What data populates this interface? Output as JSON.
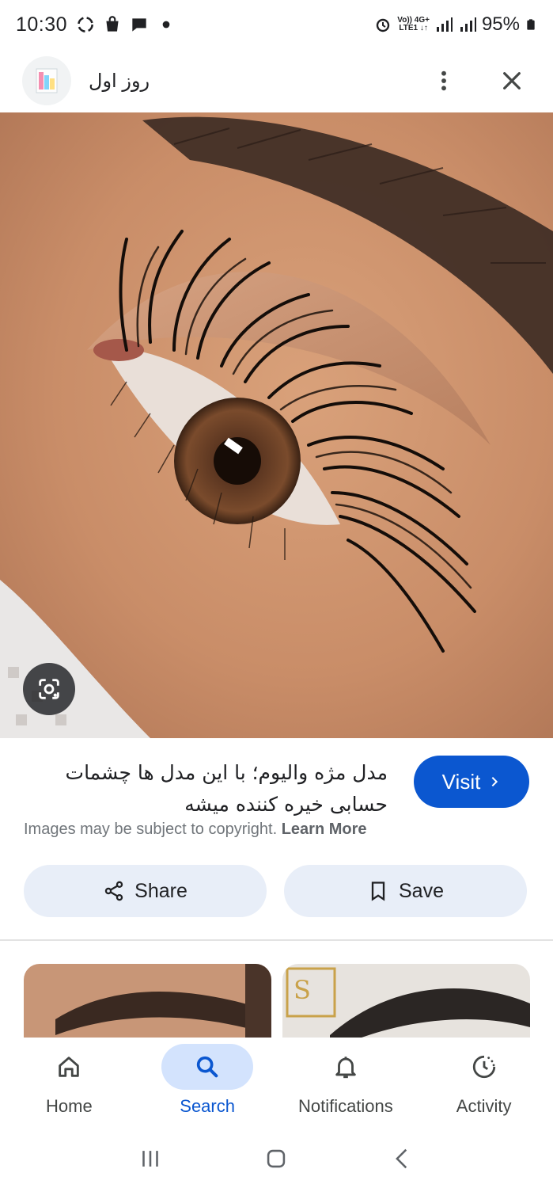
{
  "status_bar": {
    "time": "10:30",
    "battery": "95%",
    "network_top": "Vo)) 4G+",
    "network_bottom": "LTE1 ↓↑",
    "icons": [
      "sync-icon",
      "store-icon",
      "chat-icon",
      "dot-icon",
      "alarm-icon",
      "signal-icon",
      "signal-icon",
      "battery-icon"
    ]
  },
  "app_bar": {
    "site_name": "روز اول",
    "favicon": "site-favicon-icon",
    "more_icon": "more-vert-icon",
    "close_icon": "close-icon"
  },
  "image": {
    "subject": "eyelash-closeup-photo",
    "lens_icon": "google-lens-icon"
  },
  "caption": {
    "title": "مدل مژه والیوم؛ با این مدل ها چشمات حسابی خیره کننده میشه",
    "visit_label": "Visit",
    "copyright_text": "Images may be subject to copyright.",
    "learn_more": "Learn More"
  },
  "actions": {
    "share_label": "Share",
    "save_label": "Save"
  },
  "bottom_nav": {
    "items": [
      {
        "label": "Home",
        "icon": "home-icon"
      },
      {
        "label": "Search",
        "icon": "search-icon"
      },
      {
        "label": "Notifications",
        "icon": "bell-icon"
      },
      {
        "label": "Activity",
        "icon": "activity-icon"
      }
    ],
    "active": "Search"
  },
  "colors": {
    "accent": "#0b57d0",
    "pill_bg": "#e8eef8",
    "nav_active_bg": "#d3e3fd"
  }
}
